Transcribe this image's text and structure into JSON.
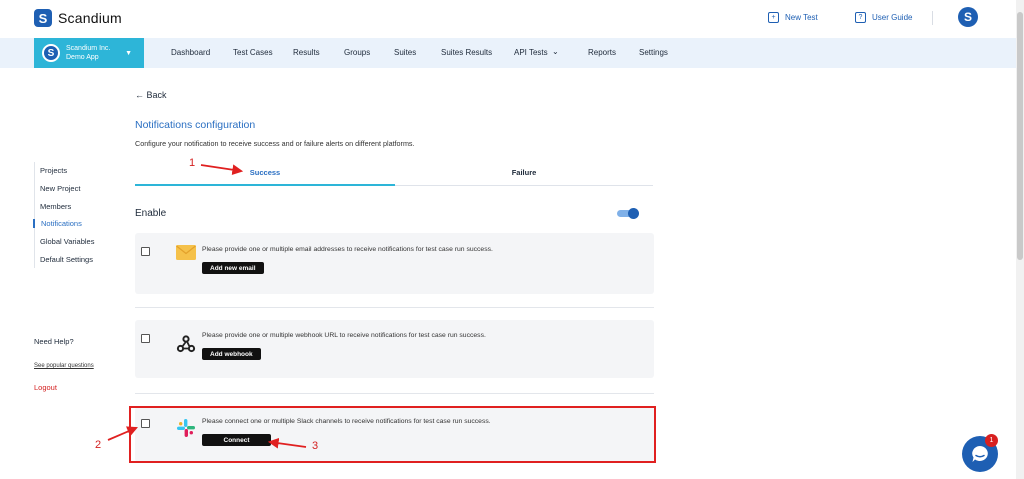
{
  "app": {
    "name": "Scandium"
  },
  "top_actions": {
    "new_test": "New Test",
    "user_guide": "User Guide"
  },
  "project": {
    "org": "Scandium Inc.",
    "app": "Demo App"
  },
  "nav": [
    "Dashboard",
    "Test Cases",
    "Results",
    "Groups",
    "Suites",
    "Suites Results",
    "API Tests",
    "Reports",
    "Settings"
  ],
  "back_label": "Back",
  "page": {
    "title": "Notifications configuration",
    "description": "Configure your notification to receive success and or failure alerts on different platforms."
  },
  "sidebar": {
    "items": [
      "Projects",
      "New Project",
      "Members",
      "Notifications",
      "Global Variables",
      "Default Settings"
    ],
    "active": "Notifications",
    "help_title": "Need Help?",
    "help_link": "See popular questions",
    "logout": "Logout"
  },
  "tabs": {
    "success": "Success",
    "failure": "Failure",
    "active": "Success"
  },
  "enable": {
    "label": "Enable",
    "on": true
  },
  "cards": [
    {
      "text": "Please provide one or multiple email addresses to receive notifications for test case run success.",
      "button": "Add new email",
      "icon": "email-icon",
      "checked": false
    },
    {
      "text": "Please provide one or multiple webhook URL to receive notifications for test case run success.",
      "button": "Add webhook",
      "icon": "webhook-icon",
      "checked": false
    },
    {
      "text": "Please connect one or multiple Slack channels to receive notifications for test case run success.",
      "button": "Connect",
      "icon": "slack-icon",
      "checked": false
    }
  ],
  "annotations": [
    "1",
    "2",
    "3"
  ],
  "chat": {
    "badge": "1"
  },
  "colors": {
    "brand": "#1e5fb3",
    "accent": "#2db5d8",
    "annotation": "#e02020"
  }
}
